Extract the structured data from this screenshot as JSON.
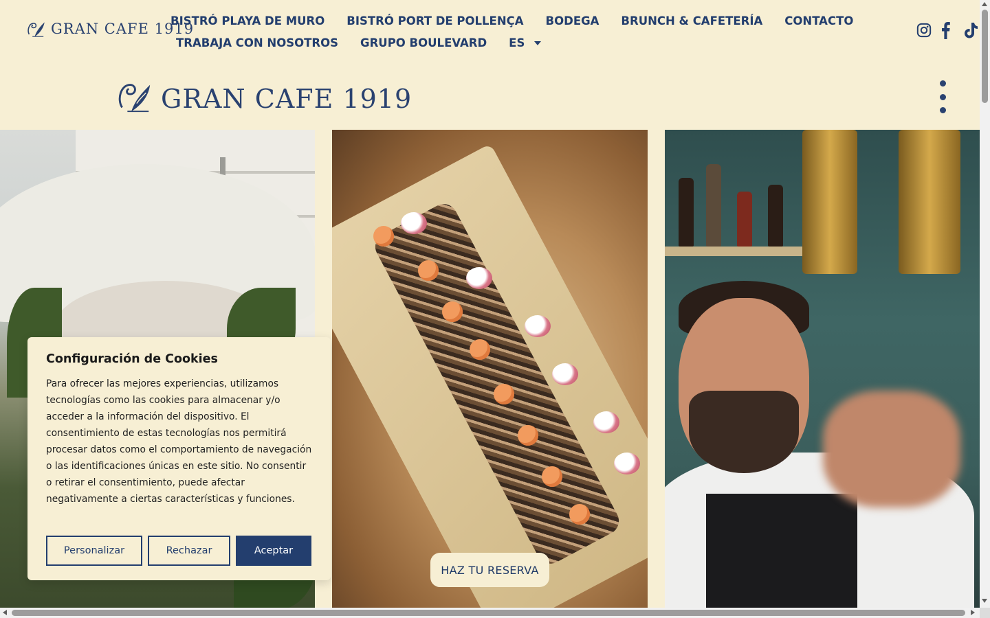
{
  "brand": {
    "name": "GRAN CAFE 1919",
    "logo_icon": "swan-leaf-emblem",
    "color_primary": "#233e6e",
    "color_background": "#f7efd4"
  },
  "nav": {
    "row1": [
      "BISTRÓ PLAYA DE MURO",
      "BISTRÓ PORT DE POLLENÇA",
      "BODEGA",
      "BRUNCH & CAFETERÍA",
      "CONTACTO"
    ],
    "row2": [
      "TRABAJA CON NOSOTROS",
      "GRUPO BOULEVARD"
    ],
    "language": "ES"
  },
  "social": [
    "instagram-icon",
    "facebook-icon",
    "tiktok-icon"
  ],
  "header": {
    "menu_icon": "kebab-menu-icon"
  },
  "hero": {
    "panels": [
      "terrace-umbrellas-photo",
      "seared-tuna-dish-photo",
      "bartender-photo"
    ],
    "cta_label": "HAZ TU RESERVA"
  },
  "cookie": {
    "title": "Configuración de Cookies",
    "body": "Para ofrecer las mejores experiencias, utilizamos tecnologías como las cookies para almacenar y/o acceder a la información del dispositivo. El consentimiento de estas tecnologías nos permitirá procesar datos como el comportamiento de navegación o las identificaciones únicas en este sitio. No consentir o retirar el consentimiento, puede afectar negativamente a ciertas características y funciones.",
    "customize_label": "Personalizar",
    "reject_label": "Rechazar",
    "accept_label": "Aceptar"
  }
}
